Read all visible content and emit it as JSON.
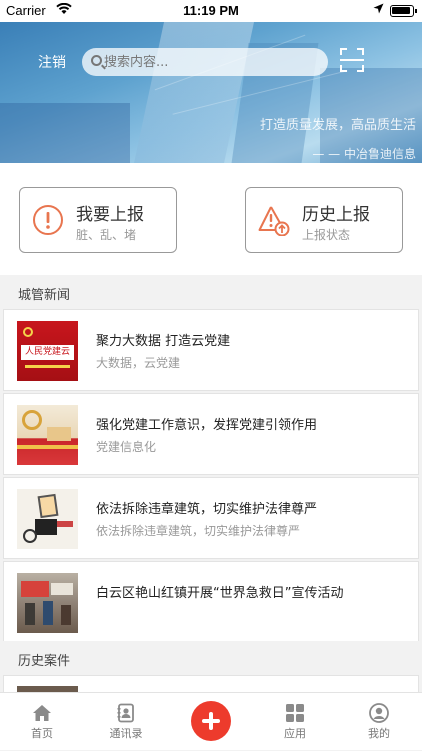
{
  "status_bar": {
    "carrier": "Carrier",
    "time": "11:19 PM"
  },
  "header": {
    "logout_label": "注销",
    "search_placeholder": "搜索内容...",
    "slogan": "打造质量发展，高品质生活",
    "company": "— — 中冶鲁迪信息"
  },
  "actions": [
    {
      "title": "我要上报",
      "subtitle": "脏、乱、堵",
      "icon": "exclamation-circle-icon"
    },
    {
      "title": "历史上报",
      "subtitle": "上报状态",
      "icon": "warning-upload-icon"
    }
  ],
  "news_section": {
    "title": "城管新闻",
    "items": [
      {
        "title": "聚力大数据 打造云党建",
        "subtitle": "大数据，云党建",
        "thumb_text": "人民党建云"
      },
      {
        "title": "强化党建工作意识，发挥党建引领作用",
        "subtitle": "党建信息化",
        "thumb_text": ""
      },
      {
        "title": "依法拆除违章建筑，切实维护法律尊严",
        "subtitle": "依法拆除违章建筑，切实维护法律尊严",
        "thumb_text": ""
      },
      {
        "title": "白云区艳山红镇开展“世界急救日”宣传活动",
        "subtitle": "",
        "thumb_text": ""
      }
    ]
  },
  "history_section": {
    "title": "历史案件"
  },
  "tabbar": {
    "items": [
      {
        "label": "首页",
        "icon": "home-icon"
      },
      {
        "label": "通讯录",
        "icon": "contacts-icon"
      },
      {
        "label": "",
        "icon": "plus-icon"
      },
      {
        "label": "应用",
        "icon": "apps-grid-icon"
      },
      {
        "label": "我的",
        "icon": "profile-icon"
      }
    ]
  },
  "colors": {
    "accent": "#ed3b2c",
    "icon_orange": "#e8754f"
  }
}
